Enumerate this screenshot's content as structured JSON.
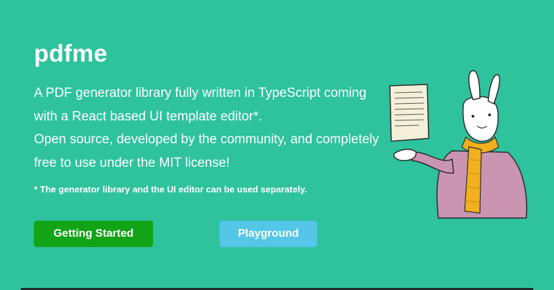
{
  "hero": {
    "title": "pdfme",
    "description_lines": [
      "A PDF generator library fully written in TypeScript coming",
      "with a React based UI template editor*.",
      "Open source, developed by the community, and completely",
      "free to use under the MIT license!"
    ],
    "note": "* The generator library and the UI editor can be used separately."
  },
  "buttons": {
    "getting_started": "Getting Started",
    "playground": "Playground"
  },
  "colors": {
    "background": "#2ec29d",
    "primary_button": "#12a317",
    "secondary_button": "#54c6e8"
  },
  "illustration": {
    "icon": "rabbit-holding-document-illustration"
  }
}
